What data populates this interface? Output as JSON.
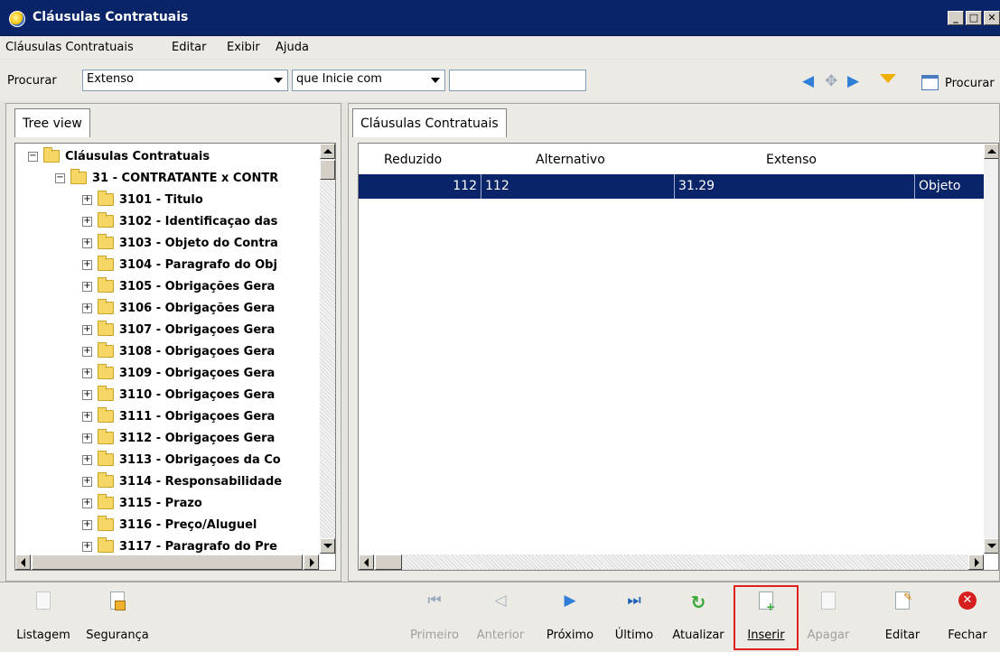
{
  "window": {
    "title": "Cláusulas Contratuais",
    "controls": [
      "_",
      "□",
      "✕"
    ]
  },
  "menu": [
    "Cláusulas Contratuais",
    "Editar",
    "Exibir",
    "Ajuda"
  ],
  "search": {
    "label": "Procurar",
    "field": "Extenso",
    "mode": "que Inicie com",
    "value": "",
    "find_label": "Procurar"
  },
  "tree_panel": {
    "tab": "Tree view",
    "root": "Cláusulas Contratuais",
    "child": "31 - CONTRATANTE x CONTR",
    "items": [
      "3101 - Titulo",
      "3102 - Identificaçao das",
      "3103 - Objeto do Contra",
      "3104 - Paragrafo do Obj",
      "3105 - Obrigações Gera",
      "3106 - Obrigações Gera",
      "3107 - Obrigaçoes Gera",
      "3108 - Obrigaçoes Gera",
      "3109 - Obrigaçoes Gera",
      "3110 - Obrigaçoes Gera",
      "3111 - Obrigaçoes Gera",
      "3112 - Obrigaçoes Gera",
      "3113 - Obrigaçoes da Co",
      "3114 - Responsabilidade",
      "3115 - Prazo",
      "3116 - Preço/Aluguel",
      "3117 - Paragrafo do Pre"
    ]
  },
  "grid_panel": {
    "tab": "Cláusulas Contratuais",
    "columns": [
      "Reduzido",
      "Alternativo",
      "Extenso"
    ],
    "rows": [
      {
        "reduzido": "112",
        "alternativo": "112",
        "extenso": "31.29",
        "extra": "Objeto"
      }
    ]
  },
  "toolbar": {
    "listagem": "Listagem",
    "seguranca": "Segurança",
    "primeiro": "Primeiro",
    "anterior": "Anterior",
    "proximo": "Próximo",
    "ultimo": "Último",
    "atualizar": "Atualizar",
    "inserir": "Inserir",
    "apagar": "Apagar",
    "editar": "Editar",
    "fechar": "Fechar"
  },
  "colors": {
    "titlebar": "#0a246a",
    "selection": "#0a246a",
    "highlight_box": "#e0201a",
    "nav_blue": "#2f7fd8",
    "refresh_green": "#3aa83a",
    "close_red": "#d62020"
  }
}
